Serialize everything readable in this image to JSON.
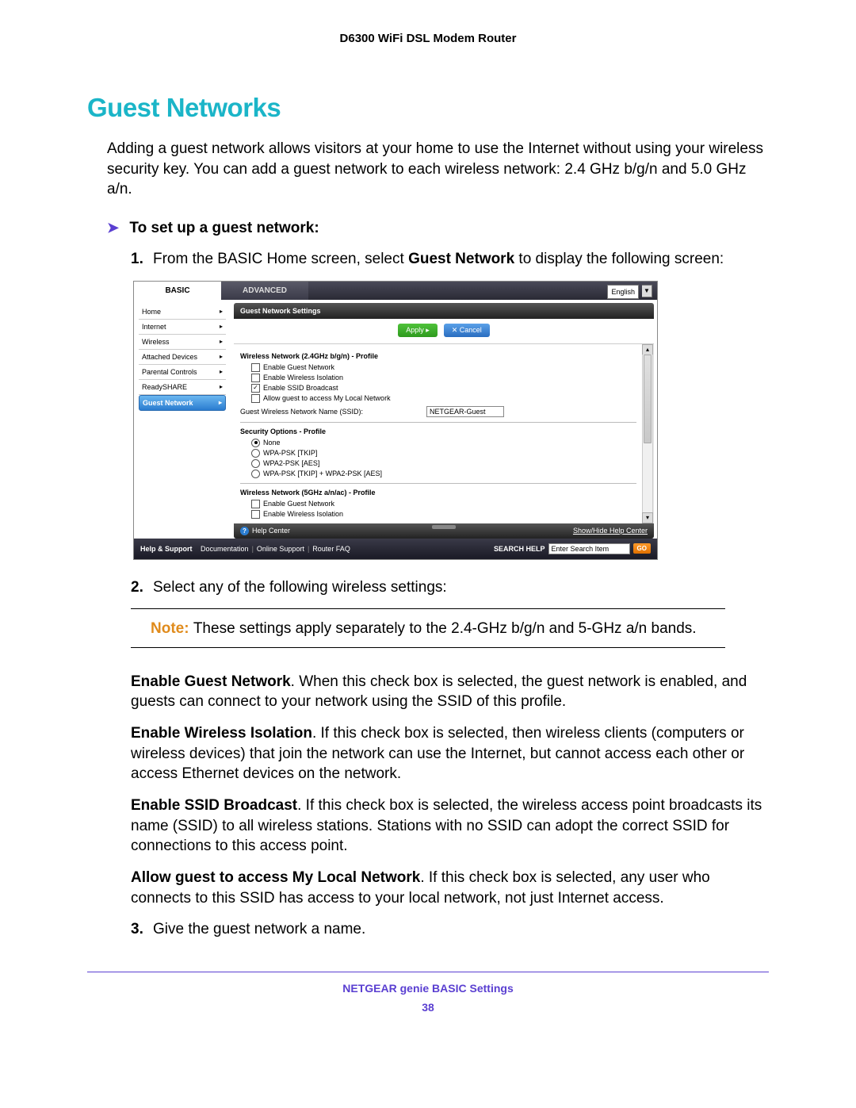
{
  "header": {
    "product": "D6300 WiFi DSL Modem Router"
  },
  "section": {
    "title": "Guest Networks",
    "intro": "Adding a guest network allows visitors at your home to use the Internet without using your wireless security key. You can add a guest network to each wireless network: 2.4 GHz b/g/n and 5.0 GHz a/n.",
    "lead": "To set up a guest network:"
  },
  "steps": {
    "s1_num": "1.",
    "s1_a": "From the BASIC Home screen, select ",
    "s1_b": "Guest Network",
    "s1_c": " to display the following screen:",
    "s2_num": "2.",
    "s2": "Select any of the following wireless settings:",
    "s3_num": "3.",
    "s3": "Give the guest network a name."
  },
  "note": {
    "label": "Note: ",
    "text": "These settings apply separately to the 2.4-GHz b/g/n and 5-GHz a/n bands."
  },
  "details": {
    "p1_b": "Enable Guest Network",
    "p1": ". When this check box is selected, the guest network is enabled, and guests can connect to your network using the SSID of this profile.",
    "p2_b": "Enable Wireless Isolation",
    "p2": ". If this check box is selected, then wireless clients (computers or wireless devices) that join the network can use the Internet, but cannot access each other or access Ethernet devices on the network.",
    "p3_b": "Enable SSID Broadcast",
    "p3": ". If this check box is selected, the wireless access point broadcasts its name (SSID) to all wireless stations. Stations with no SSID can adopt the correct SSID for connections to this access point.",
    "p4_b": "Allow guest to access My Local Network",
    "p4": ". If this check box is selected, any user who connects to this SSID has access to your local network, not just Internet access."
  },
  "shot": {
    "tabs": {
      "basic": "BASIC",
      "advanced": "ADVANCED"
    },
    "language": "English",
    "sidebar": [
      "Home",
      "Internet",
      "Wireless",
      "Attached Devices",
      "Parental Controls",
      "ReadySHARE",
      "Guest Network"
    ],
    "panel_title": "Guest Network Settings",
    "buttons": {
      "apply": "Apply ▸",
      "cancel": "✕ Cancel"
    },
    "net24_title": "Wireless Network (2.4GHz b/g/n) - Profile",
    "chk_enable_guest": "Enable Guest Network",
    "chk_enable_iso": "Enable Wireless Isolation",
    "chk_enable_ssid": "Enable SSID Broadcast",
    "chk_allow_local": "Allow guest to access My Local Network",
    "ssid_label": "Guest Wireless Network Name (SSID):",
    "ssid_value": "NETGEAR-Guest",
    "sec_title": "Security Options - Profile",
    "sec_opts": [
      "None",
      "WPA-PSK [TKIP]",
      "WPA2-PSK [AES]",
      "WPA-PSK [TKIP] + WPA2-PSK [AES]"
    ],
    "net5_title": "Wireless Network (5GHz a/n/ac) - Profile",
    "help_center": "Help Center",
    "show_hide": "Show/Hide Help Center",
    "footer": {
      "help_support": "Help & Support",
      "doc": "Documentation",
      "online": "Online Support",
      "faq": "Router FAQ",
      "search_label": "SEARCH HELP",
      "search_ph": "Enter Search Item",
      "go": "GO"
    }
  },
  "page_footer": {
    "line1": "NETGEAR genie BASIC Settings",
    "page_no": "38"
  }
}
